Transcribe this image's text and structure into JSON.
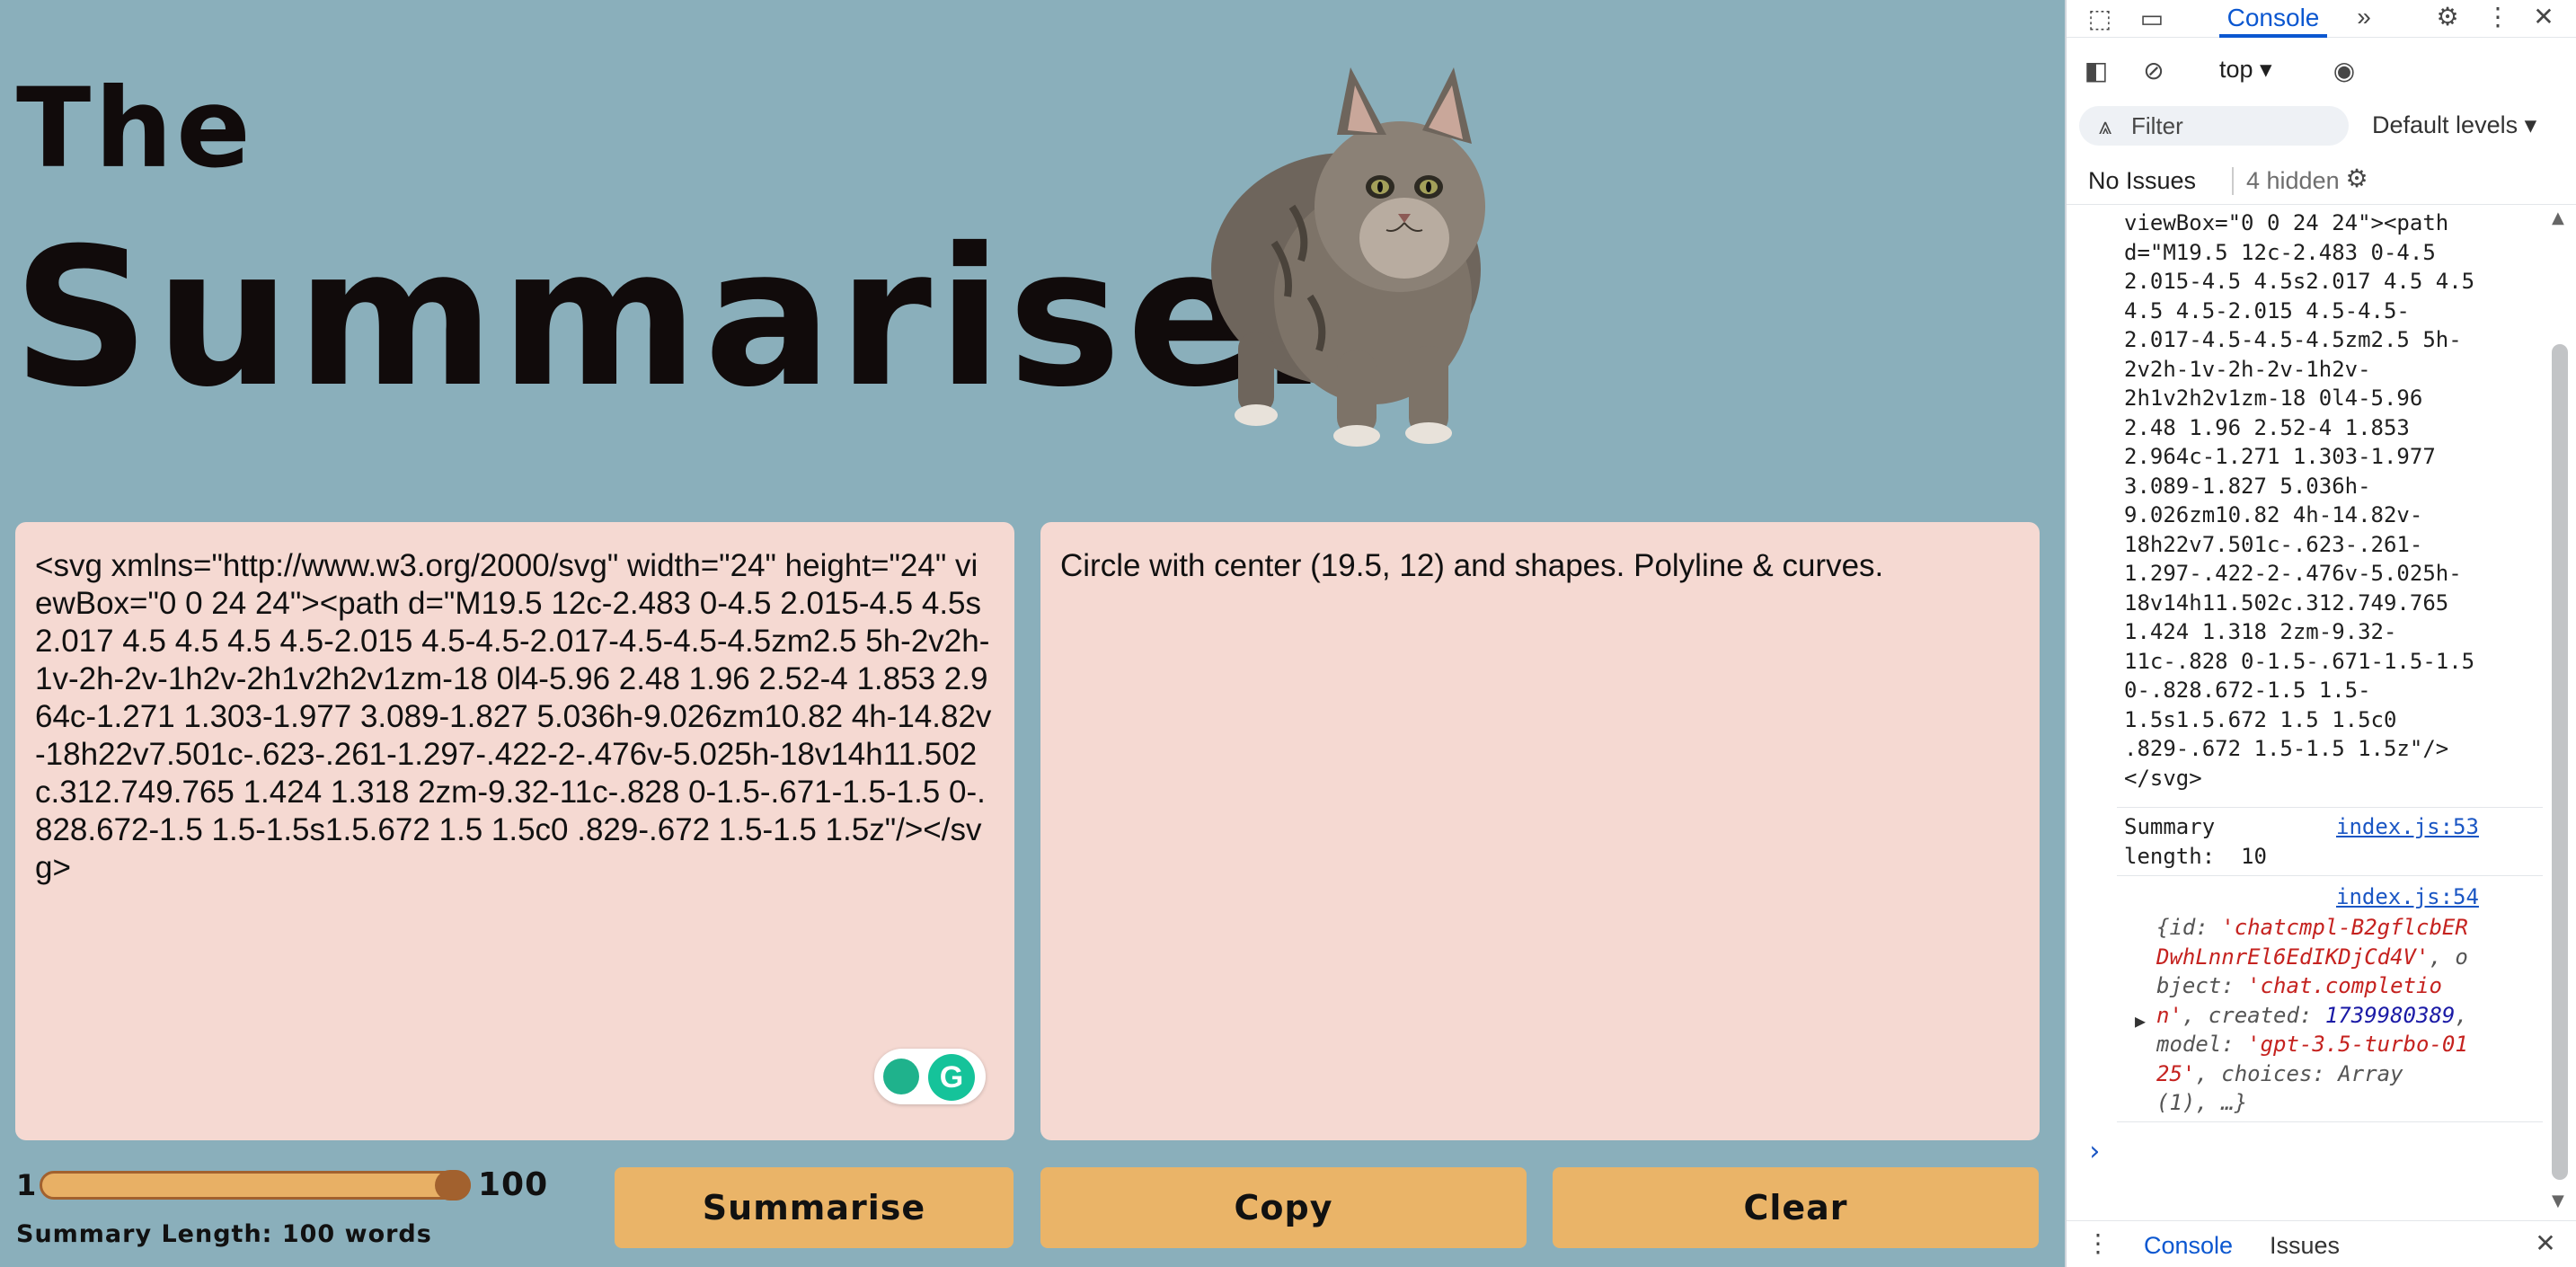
{
  "app": {
    "title_line1": "The",
    "title_line2": "Summariser",
    "input_text": "<svg xmlns=\"http://www.w3.org/2000/svg\" width=\"24\" height=\"24\" viewBox=\"0 0 24 24\"><path d=\"M19.5 12c-2.483 0-4.5 2.015-4.5 4.5s2.017 4.5 4.5 4.5 4.5-2.015 4.5-4.5-2.017-4.5-4.5-4.5zm2.5 5h-2v2h-1v-2h-2v-1h2v-2h1v2h2v1zm-18 0l4-5.96 2.48 1.96 2.52-4 1.853 2.964c-1.271 1.303-1.977 3.089-1.827 5.036h-9.026zm10.82 4h-14.82v-18h22v7.501c-.623-.261-1.297-.422-2-.476v-5.025h-18v14h11.502c.312.749.765 1.424 1.318 2zm-9.32-11c-.828 0-1.5-.671-1.5-1.5 0-.828.672-1.5 1.5-1.5s1.5.672 1.5 1.5c0 .829-.672 1.5-1.5 1.5z\"/></svg>",
    "output_text": "Circle with center (19.5, 12) and shapes. Polyline & curves.",
    "slider": {
      "min_label": "1",
      "max_label": "100",
      "value": 100
    },
    "summary_length_text": "Summary Length: 100 words",
    "buttons": {
      "summarise": "Summarise",
      "copy": "Copy",
      "clear": "Clear"
    },
    "colors": {
      "background": "#8aafbb",
      "panel": "#f5d9d2",
      "button": "#eab468",
      "slider_fill": "#e8b065",
      "slider_thumb": "#a2612e"
    }
  },
  "devtools": {
    "tab_console": "Console",
    "context": "top",
    "filter_placeholder": "Filter",
    "levels": "Default levels",
    "no_issues": "No Issues",
    "hidden": "4 hidden",
    "log_text": "viewBox=\"0 0 24 24\"><path\nd=\"M19.5 12c-2.483 0-4.5\n2.015-4.5 4.5s2.017 4.5 4.5\n4.5 4.5-2.015 4.5-4.5-\n2.017-4.5-4.5-4.5zm2.5 5h-\n2v2h-1v-2h-2v-1h2v-\n2h1v2h2v1zm-18 0l4-5.96\n2.48 1.96 2.52-4 1.853\n2.964c-1.271 1.303-1.977\n3.089-1.827 5.036h-\n9.026zm10.82 4h-14.82v-\n18h22v7.501c-.623-.261-\n1.297-.422-2-.476v-5.025h-\n18v14h11.502c.312.749.765\n1.424 1.318 2zm-9.32-\n11c-.828 0-1.5-.671-1.5-1.5\n0-.828.672-1.5 1.5-\n1.5s1.5.672 1.5 1.5c0\n.829-.672 1.5-1.5 1.5z\"/>\n</svg>",
    "summary_log_label": "Summary\nlength:  10",
    "source_53": "index.js:53",
    "source_54": "index.js:54",
    "object_log": {
      "l1_a": "{id: ",
      "l1_b": "'chatcmpl-B2gflcbER",
      "l2_a": "DwhLnnrEl6EdIKDjCd4V'",
      "l2_b": ", o",
      "l3_a": "bject: ",
      "l3_b": "'chat.completio",
      "l4_a": "n'",
      "l4_b": ", created: ",
      "l4_c": "1739980389",
      "l4_d": ",",
      "l5_a": "model: ",
      "l5_b": "'gpt-3.5-turbo-01",
      "l6_a": "25'",
      "l6_b": ", choices: Array",
      "l7": "(1), …}"
    },
    "prompt": "›",
    "bottom_console": "Console",
    "bottom_issues": "Issues"
  }
}
